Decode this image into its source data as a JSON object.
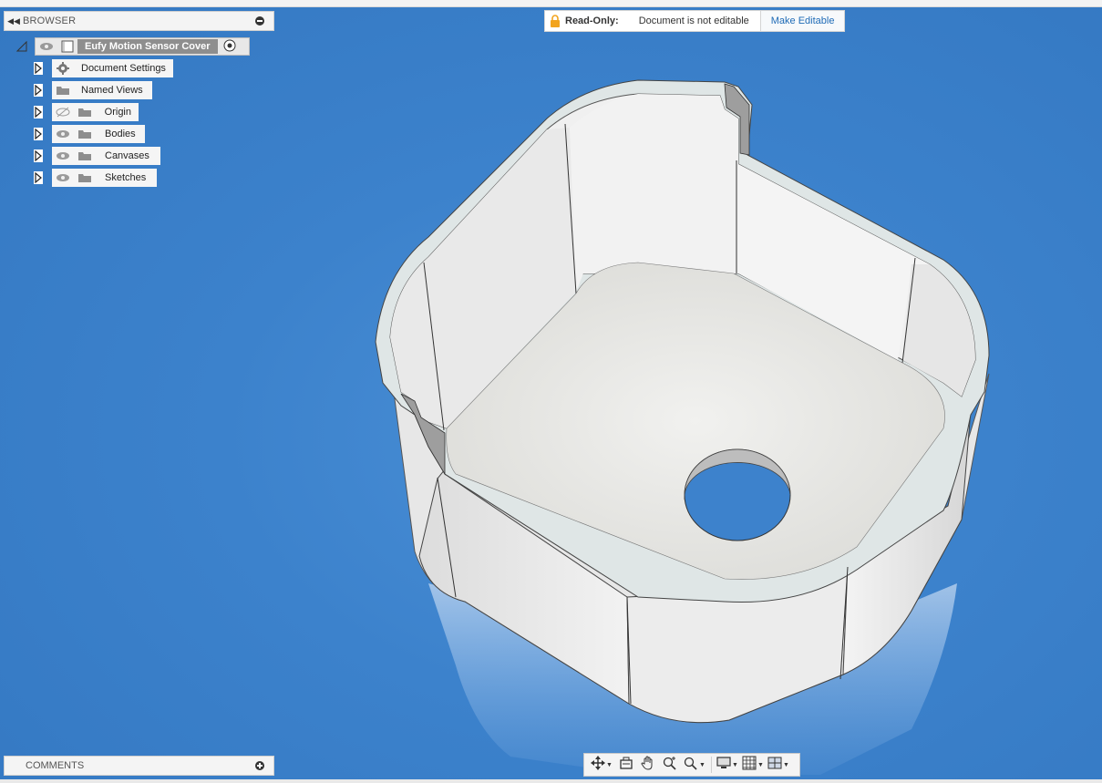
{
  "browser": {
    "title": "BROWSER",
    "root": {
      "label": "Eufy Motion Sensor Cover"
    },
    "items": [
      {
        "label": "Document Settings",
        "icon": "gear-icon"
      },
      {
        "label": "Named Views",
        "icon": "folder-icon"
      },
      {
        "label": "Origin",
        "icon": "folder-icon",
        "visibility": "hidden"
      },
      {
        "label": "Bodies",
        "icon": "folder-icon",
        "visibility": "visible"
      },
      {
        "label": "Canvases",
        "icon": "folder-icon",
        "visibility": "visible"
      },
      {
        "label": "Sketches",
        "icon": "folder-icon",
        "visibility": "visible"
      }
    ]
  },
  "banner": {
    "label": "Read-Only:",
    "message": "Document is not editable",
    "action": "Make Editable",
    "lock_color": "#f2a41e"
  },
  "comments": {
    "title": "COMMENTS"
  },
  "navbar": {
    "tools": [
      "orbit-icon",
      "look-at-icon",
      "pan-icon",
      "zoom-icon",
      "fit-icon",
      "display-settings-icon",
      "grid-icon",
      "viewports-icon"
    ]
  },
  "colors": {
    "background": "#3f7fc3",
    "link": "#1f6bb6"
  }
}
